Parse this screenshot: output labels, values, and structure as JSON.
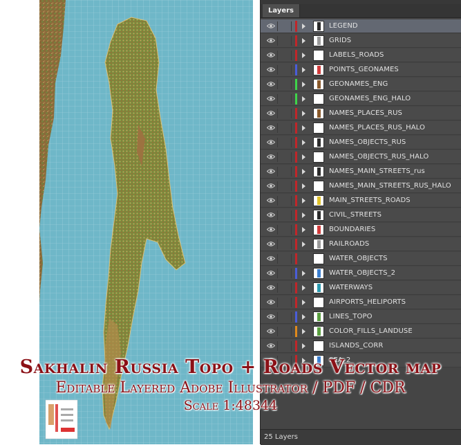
{
  "panel": {
    "tab_label": "Layers",
    "layer_count_label": "25 Layers"
  },
  "layers": [
    {
      "name": "LEGEND",
      "color": "#c0262a",
      "selected": true,
      "thumb": "dark"
    },
    {
      "name": "GRIDS",
      "color": "#c0262a",
      "thumb": "grey"
    },
    {
      "name": "LABELS_ROADS",
      "color": "#c0262a",
      "thumb": "none"
    },
    {
      "name": "POINTS_GEONAMES",
      "color": "#4a5dd8",
      "thumb": "red"
    },
    {
      "name": "GEONAMES_ENG",
      "color": "#3fd44a",
      "thumb": "brown"
    },
    {
      "name": "GEONAMES_ENG_HALO",
      "color": "#3fd44a",
      "thumb": "none"
    },
    {
      "name": "NAMES_PLACES_RUS",
      "color": "#c0262a",
      "thumb": "brown"
    },
    {
      "name": "NAMES_PLACES_RUS_HALO",
      "color": "#c0262a",
      "thumb": "none"
    },
    {
      "name": "NAMES_OBJECTS_RUS",
      "color": "#c0262a",
      "thumb": "dark"
    },
    {
      "name": "NAMES_OBJECTS_RUS_HALO",
      "color": "#c0262a",
      "thumb": "none"
    },
    {
      "name": "NAMES_MAIN_STREETS_rus",
      "color": "#c0262a",
      "thumb": "dark"
    },
    {
      "name": "NAMES_MAIN_STREETS_RUS_HALO",
      "color": "#c0262a",
      "thumb": "none"
    },
    {
      "name": "MAIN_STREETS_ROADS",
      "color": "#c0262a",
      "thumb": "yellow"
    },
    {
      "name": "CIVIL_STREETS",
      "color": "#c0262a",
      "thumb": "dark"
    },
    {
      "name": "BOUNDARIES",
      "color": "#c0262a",
      "thumb": "red"
    },
    {
      "name": "RAILROADS",
      "color": "#c0262a",
      "thumb": "grey"
    },
    {
      "name": "WATER_OBJECTS",
      "color": "#c0262a",
      "thumb": "none",
      "no_arrow": true
    },
    {
      "name": "WATER_OBJECTS_2",
      "color": "#4a5dd8",
      "thumb": "blue"
    },
    {
      "name": "WATERWAYS",
      "color": "#c0262a",
      "thumb": "teal"
    },
    {
      "name": "AIRPORTS_HELIPORTS",
      "color": "#c0262a",
      "thumb": "none"
    },
    {
      "name": "LINES_TOPO",
      "color": "#4a5dd8",
      "thumb": "green"
    },
    {
      "name": "COLOR_FILLS_LANDUSE",
      "color": "#e08a1c",
      "thumb": "green"
    },
    {
      "name": "ISLANDS_CORR",
      "color": "#c0262a",
      "thumb": "none"
    },
    {
      "name": "SEA_2",
      "color": "#c0262a",
      "thumb": "blue"
    }
  ],
  "map": {
    "sea_color": "#6fb7c8",
    "land_color": "#8a6a3a",
    "forest_color": "#6f8a3e",
    "grid_color": "#a9d3df"
  },
  "caption": {
    "title": "Sakhalin Russia Topo + Roads Vector map",
    "subtitle": "Editable Layered Adobe Illustrator / PDF / CDR",
    "scale": "Scale 1:48344",
    "color": "#8b1016"
  }
}
